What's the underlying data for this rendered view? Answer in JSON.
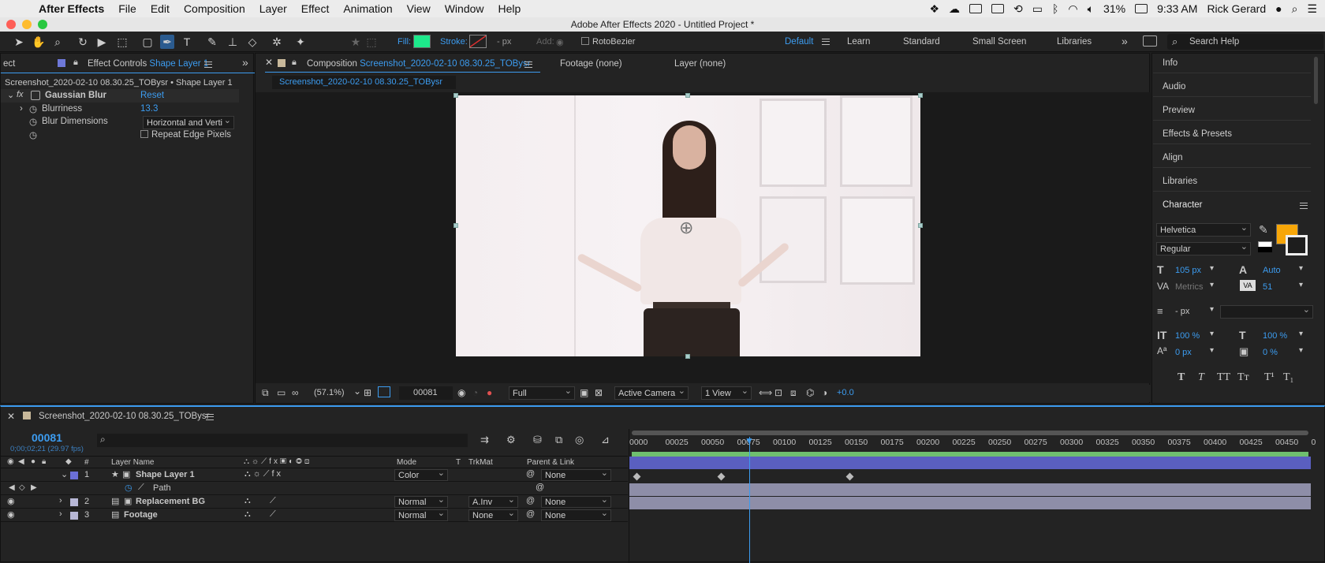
{
  "menubar": {
    "app": "After Effects",
    "items": [
      "File",
      "Edit",
      "Composition",
      "Layer",
      "Effect",
      "Animation",
      "View",
      "Window",
      "Help"
    ],
    "battery": "31%",
    "time": "9:33 AM",
    "user": "Rick Gerard"
  },
  "window": {
    "title": "Adobe After Effects 2020 - Untitled Project *"
  },
  "toolbar": {
    "fill_label": "Fill:",
    "stroke_label": "Stroke:",
    "stroke_px": "- px",
    "add_label": "Add:",
    "rotobezier": "RotoBezier",
    "fill_color": "#1de98b",
    "workspaces": [
      "Default",
      "Learn",
      "Standard",
      "Small Screen",
      "Libraries"
    ],
    "search_help": "Search Help"
  },
  "effect_controls": {
    "left_tab": "ect",
    "tab_prefix": "Effect Controls",
    "tab_layer": "Shape Layer 1",
    "breadcrumb": "Screenshot_2020-02-10 08.30.25_TOBysr • Shape Layer 1",
    "effect_name": "Gaussian Blur",
    "reset": "Reset",
    "blurriness_label": "Blurriness",
    "blurriness_value": "13.3",
    "dimensions_label": "Blur Dimensions",
    "dimensions_value": "Horizontal and Verti",
    "repeat_edge": "Repeat Edge Pixels"
  },
  "composition": {
    "tab_prefix": "Composition",
    "tab_name": "Screenshot_2020-02-10 08.30.25_TOBysr",
    "footage_tab": "Footage (none)",
    "layer_tab": "Layer (none)",
    "subtab": "Screenshot_2020-02-10 08.30.25_TOBysr",
    "zoom": "(57.1%)",
    "timecode": "00081",
    "resolution": "Full",
    "camera": "Active Camera",
    "views": "1 View",
    "exposure": "+0.0"
  },
  "right_panel": {
    "items": [
      "Info",
      "Audio",
      "Preview",
      "Effects & Presets",
      "Align",
      "Libraries"
    ],
    "character_title": "Character",
    "font": "Helvetica",
    "style": "Regular",
    "font_size": "105 px",
    "leading": "Auto",
    "kerning": "Metrics",
    "tracking": "51",
    "stroke_width": "- px",
    "vscale": "100 %",
    "hscale": "100 %",
    "baseline": "0 px",
    "tsume": "0 %",
    "fill_color": "#f7a608",
    "type_buttons": [
      "T",
      "T",
      "TT",
      "Tт",
      "T¹",
      "T₁"
    ]
  },
  "timeline": {
    "tab": "Screenshot_2020-02-10 08.30.25_TOBysr",
    "timecode": "00081",
    "timecode_sub": "0;00;02;21 (29.97 fps)",
    "ruler": [
      "0000",
      "00025",
      "00050",
      "00075",
      "00100",
      "00125",
      "00150",
      "00175",
      "00200",
      "00225",
      "00250",
      "00275",
      "00300",
      "00325",
      "00350",
      "00375",
      "00400",
      "00425",
      "00450",
      "0"
    ],
    "columns": {
      "num": "#",
      "layer_name": "Layer Name",
      "mode": "Mode",
      "t": "T",
      "trkmat": "TrkMat",
      "parent": "Parent & Link"
    },
    "layers": [
      {
        "num": "1",
        "name": "Shape Layer 1",
        "mode": "Color",
        "trkmat": "",
        "parent": "None",
        "color": "#6b6fd6"
      },
      {
        "num": "",
        "name": "Path",
        "mode": "",
        "trkmat": "",
        "parent": "",
        "color": ""
      },
      {
        "num": "2",
        "name": "Replacement BG",
        "mode": "Normal",
        "trkmat": "A.Inv",
        "parent": "None",
        "color": "#b7b7d6"
      },
      {
        "num": "3",
        "name": "Footage",
        "mode": "Normal",
        "trkmat": "None",
        "parent": "None",
        "color": "#b7b7d6"
      }
    ]
  }
}
